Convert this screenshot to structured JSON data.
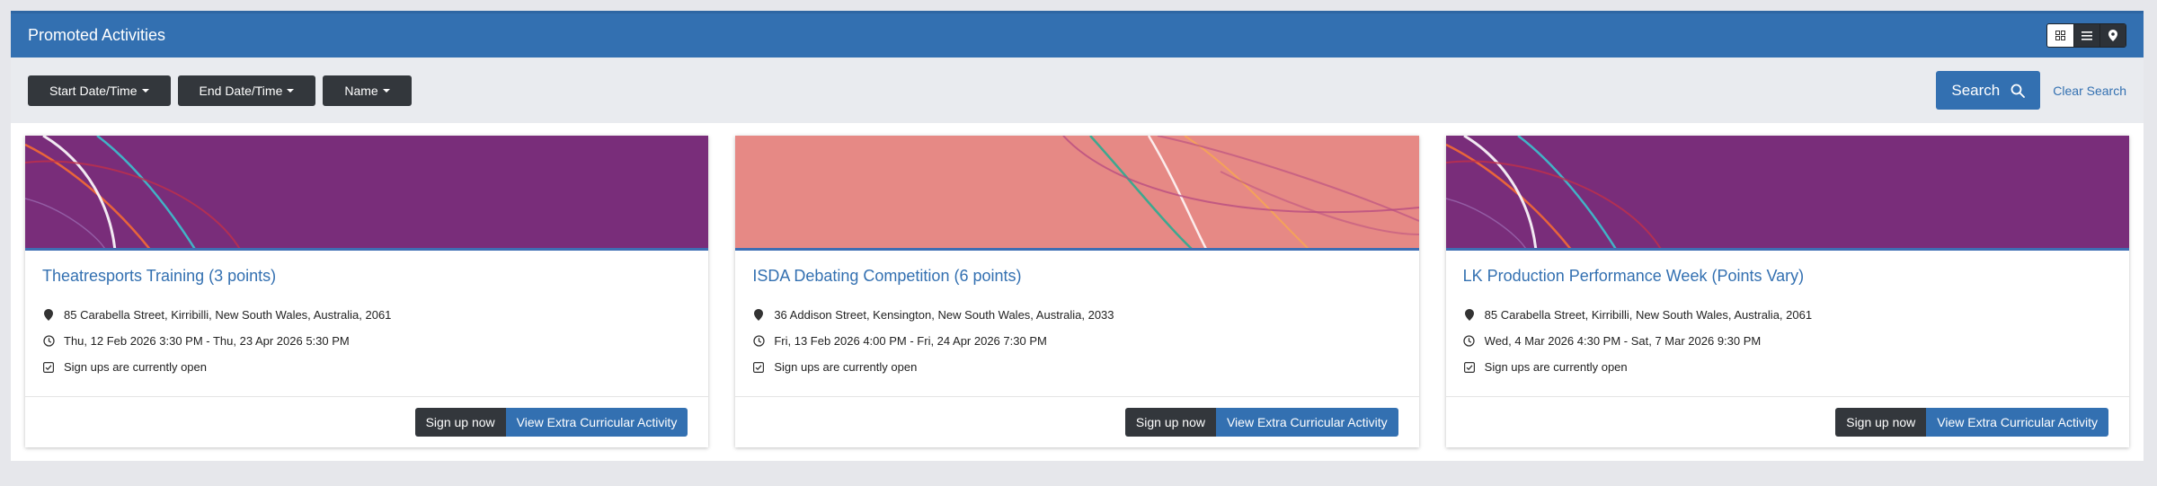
{
  "header": {
    "title": "Promoted Activities",
    "view_modes": [
      {
        "icon": "grid-icon",
        "active": true
      },
      {
        "icon": "list-icon",
        "active": false
      },
      {
        "icon": "map-pin-icon",
        "active": false
      }
    ]
  },
  "filters": {
    "buttons": [
      "Start Date/Time",
      "End Date/Time",
      "Name"
    ],
    "search_label": "Search",
    "clear_label": "Clear Search"
  },
  "colors": {
    "primary": "#3370b1",
    "dark": "#33373c",
    "banner_purple": "#792d7a",
    "banner_salmon": "#e68985"
  },
  "cards": [
    {
      "title": "Theatresports Training (3 points)",
      "location": "85 Carabella Street, Kirribilli, New South Wales, Australia, 2061",
      "datetime": "Thu, 12 Feb 2026 3:30 PM - Thu, 23 Apr 2026 5:30 PM",
      "status": "Sign ups are currently open",
      "signup_label": "Sign up now",
      "view_label": "View Extra Curricular Activity",
      "banner": "purple"
    },
    {
      "title": "ISDA Debating Competition (6 points)",
      "location": "36 Addison Street, Kensington, New South Wales, Australia, 2033",
      "datetime": "Fri, 13 Feb 2026 4:00 PM - Fri, 24 Apr 2026 7:30 PM",
      "status": "Sign ups are currently open",
      "signup_label": "Sign up now",
      "view_label": "View Extra Curricular Activity",
      "banner": "salmon"
    },
    {
      "title": "LK Production Performance Week (Points Vary)",
      "location": "85 Carabella Street, Kirribilli, New South Wales, Australia, 2061",
      "datetime": "Wed, 4 Mar 2026 4:30 PM - Sat, 7 Mar 2026 9:30 PM",
      "status": "Sign ups are currently open",
      "signup_label": "Sign up now",
      "view_label": "View Extra Curricular Activity",
      "banner": "purple"
    }
  ]
}
